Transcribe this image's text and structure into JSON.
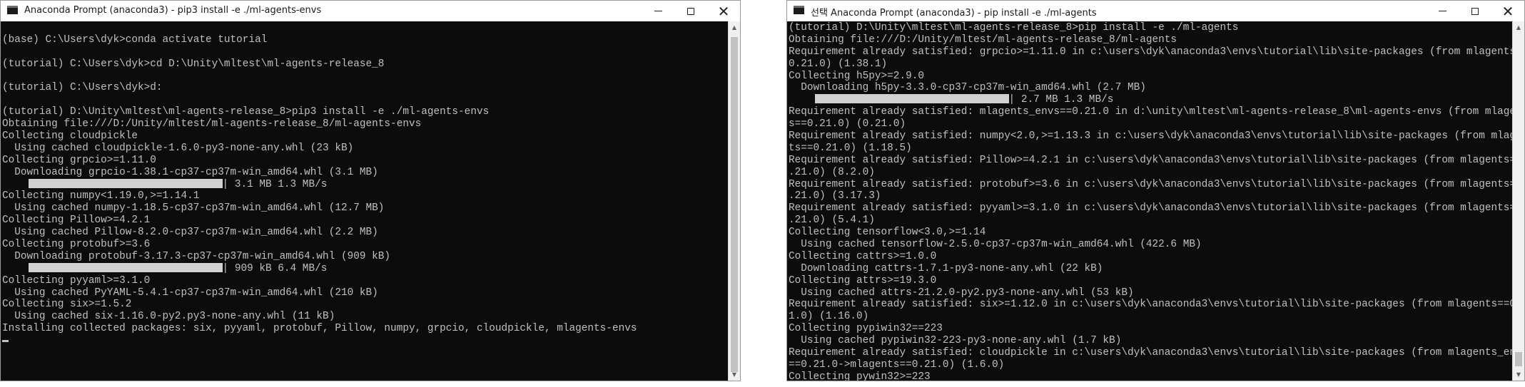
{
  "left_window": {
    "title": "Anaconda Prompt (anaconda3) - pip3  install -e ./ml-agents-envs",
    "lines": [
      "",
      "(base) C:\\Users\\dyk>conda activate tutorial",
      "",
      "(tutorial) C:\\Users\\dyk>cd D:\\Unity\\mltest\\ml-agents-release_8",
      "",
      "(tutorial) C:\\Users\\dyk>d:",
      "",
      "(tutorial) D:\\Unity\\mltest\\ml-agents-release_8>pip3 install -e ./ml-agents-envs",
      "Obtaining file:///D:/Unity/mltest/ml-agents-release_8/ml-agents-envs",
      "Collecting cloudpickle",
      "  Using cached cloudpickle-1.6.0-py3-none-any.whl (23 kB)",
      "Collecting grpcio>=1.11.0",
      "  Downloading grpcio-1.38.1-cp37-cp37m-win_amd64.whl (3.1 MB)",
      "     | 3.1 MB 1.3 MB/s",
      "Collecting numpy<1.19.0,>=1.14.1",
      "  Using cached numpy-1.18.5-cp37-cp37m-win_amd64.whl (12.7 MB)",
      "Collecting Pillow>=4.2.1",
      "  Using cached Pillow-8.2.0-cp37-cp37m-win_amd64.whl (2.2 MB)",
      "Collecting protobuf>=3.6",
      "  Downloading protobuf-3.17.3-cp37-cp37m-win_amd64.whl (909 kB)",
      "     | 909 kB 6.4 MB/s",
      "Collecting pyyaml>=3.1.0",
      "  Using cached PyYAML-5.4.1-cp37-cp37m-win_amd64.whl (210 kB)",
      "Collecting six>=1.5.2",
      "  Using cached six-1.16.0-py2.py3-none-any.whl (11 kB)",
      "Installing collected packages: six, pyyaml, protobuf, Pillow, numpy, grpcio, cloudpickle, mlagents-envs"
    ],
    "progress_bars": [
      {
        "line": 13,
        "text": "| 3.1 MB 1.3 MB/s",
        "fraction": 1.0
      },
      {
        "line": 20,
        "text": "| 909 kB 6.4 MB/s",
        "fraction": 1.0
      }
    ]
  },
  "right_window": {
    "title": "선택 Anaconda Prompt (anaconda3) - pip  install -e ./ml-agents",
    "lines": [
      "(tutorial) D:\\Unity\\mltest\\ml-agents-release_8>pip install -e ./ml-agents",
      "Obtaining file:///D:/Unity/mltest/ml-agents-release_8/ml-agents",
      "Requirement already satisfied: grpcio>=1.11.0 in c:\\users\\dyk\\anaconda3\\envs\\tutorial\\lib\\site-packages (from mlagents==",
      "0.21.0) (1.38.1)",
      "Collecting h5py>=2.9.0",
      "  Downloading h5py-3.3.0-cp37-cp37m-win_amd64.whl (2.7 MB)",
      "     | 2.7 MB 1.3 MB/s",
      "Requirement already satisfied: mlagents_envs==0.21.0 in d:\\unity\\mltest\\ml-agents-release_8\\ml-agents-envs (from mlagent",
      "s==0.21.0) (0.21.0)",
      "Requirement already satisfied: numpy<2.0,>=1.13.3 in c:\\users\\dyk\\anaconda3\\envs\\tutorial\\lib\\site-packages (from mlagen",
      "ts==0.21.0) (1.18.5)",
      "Requirement already satisfied: Pillow>=4.2.1 in c:\\users\\dyk\\anaconda3\\envs\\tutorial\\lib\\site-packages (from mlagents==0",
      ".21.0) (8.2.0)",
      "Requirement already satisfied: protobuf>=3.6 in c:\\users\\dyk\\anaconda3\\envs\\tutorial\\lib\\site-packages (from mlagents==0",
      ".21.0) (3.17.3)",
      "Requirement already satisfied: pyyaml>=3.1.0 in c:\\users\\dyk\\anaconda3\\envs\\tutorial\\lib\\site-packages (from mlagents==0",
      ".21.0) (5.4.1)",
      "Collecting tensorflow<3.0,>=1.14",
      "  Using cached tensorflow-2.5.0-cp37-cp37m-win_amd64.whl (422.6 MB)",
      "Collecting cattrs>=1.0.0",
      "  Downloading cattrs-1.7.1-py3-none-any.whl (22 kB)",
      "Collecting attrs>=19.3.0",
      "  Using cached attrs-21.2.0-py2.py3-none-any.whl (53 kB)",
      "Requirement already satisfied: six>=1.12.0 in c:\\users\\dyk\\anaconda3\\envs\\tutorial\\lib\\site-packages (from mlagents==0.2",
      "1.0) (1.16.0)",
      "Collecting pypiwin32==223",
      "  Using cached pypiwin32-223-py3-none-any.whl (1.7 kB)",
      "Requirement already satisfied: cloudpickle in c:\\users\\dyk\\anaconda3\\envs\\tutorial\\lib\\site-packages (from mlagents_envs",
      "==0.21.0->mlagents==0.21.0) (1.6.0)",
      "Collecting pywin32>=223"
    ],
    "progress_bars": [
      {
        "line": 6,
        "text": "| 2.7 MB 1.3 MB/s",
        "fraction": 1.0
      }
    ]
  },
  "icons": {
    "app": "console-icon",
    "minimize": "minimize-icon",
    "maximize": "maximize-icon",
    "close": "close-icon",
    "scroll_up": "scroll-up-arrow-icon",
    "scroll_down": "scroll-down-arrow-icon"
  },
  "glyphs": {
    "close": "✕",
    "up": "▲",
    "down": "▼"
  }
}
